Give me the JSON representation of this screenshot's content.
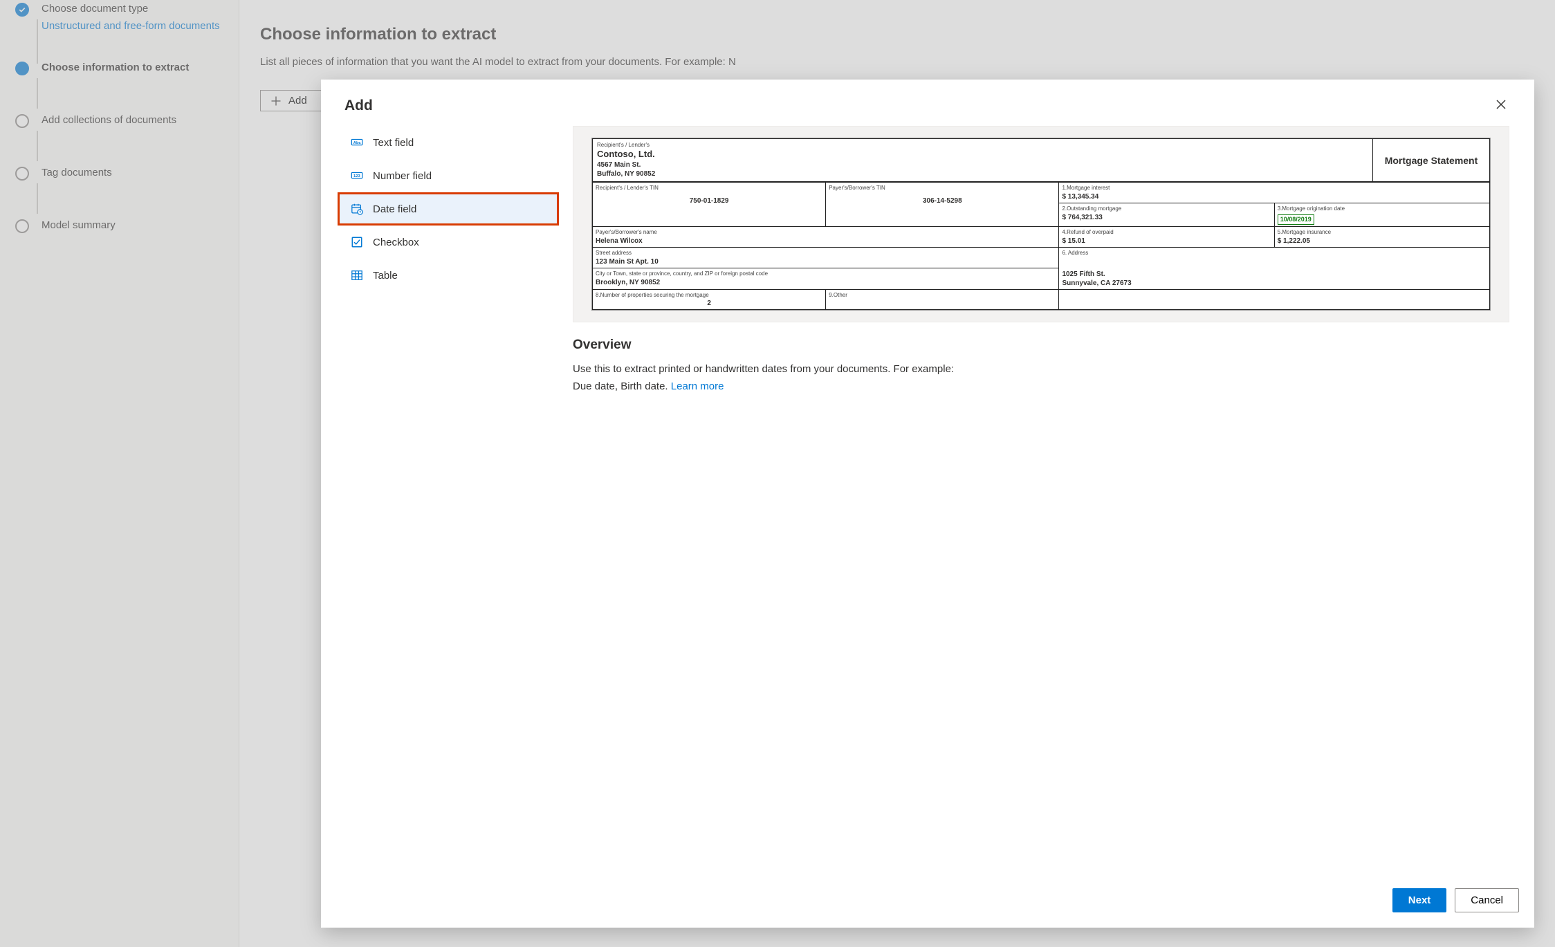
{
  "steps": [
    {
      "label": "Choose document type",
      "sub": "Unstructured and free-form documents"
    },
    {
      "label": "Choose information to extract"
    },
    {
      "label": "Add collections of documents"
    },
    {
      "label": "Tag documents"
    },
    {
      "label": "Model summary"
    }
  ],
  "main": {
    "heading": "Choose information to extract",
    "lead": "List all pieces of information that you want the AI model to extract from your documents. For example: N",
    "add_button": "Add"
  },
  "modal": {
    "title": "Add",
    "types": [
      "Text field",
      "Number field",
      "Date field",
      "Checkbox",
      "Table"
    ],
    "overview_heading": "Overview",
    "overview_text": "Use this to extract printed or handwritten dates from your documents. For example: Due date, Birth date. ",
    "learn_more": "Learn more",
    "next": "Next",
    "cancel": "Cancel"
  },
  "sample": {
    "recipient_lender_label": "Recipient's / Lender's",
    "company": "Contoso, Ltd.",
    "addr1": "4567 Main St.",
    "addr2": "Buffalo, NY 90852",
    "title": "Mortgage Statement",
    "tin_label_left": "Recipient's / Lender's TIN",
    "tin_left": "750-01-1829",
    "tin_label_right": "Payer's/Borrower's TIN",
    "tin_right": "306-14-5298",
    "f1_label": "1.Mortgage interest",
    "f1_val": "$  13,345.34",
    "f2_label": "2.Outstanding mortgage",
    "f2_val": "$  764,321.33",
    "f3_label": "3.Mortgage origination date",
    "f3_val": "10/08/2019",
    "payer_label": "Payer's/Borrower's name",
    "payer": "Helena Wilcox",
    "f4_label": "4.Refund of overpaid",
    "f4_val": "$  15.01",
    "f5_label": "5.Mortgage insurance",
    "f5_val": "$  1,222.05",
    "street_label": "Street address",
    "street": "123 Main St Apt. 10",
    "f6_label": "6. Address",
    "city_label": "City or Town, state or province, country, and ZIP or foreign postal code",
    "city": "Brooklyn, NY 90852",
    "addr_r1": "1025 Fifth St.",
    "addr_r2": "Sunnyvale, CA 27673",
    "prop_label": "8.Number of properties securing the mortgage",
    "prop_val": "2",
    "other_label": "9.Other"
  }
}
